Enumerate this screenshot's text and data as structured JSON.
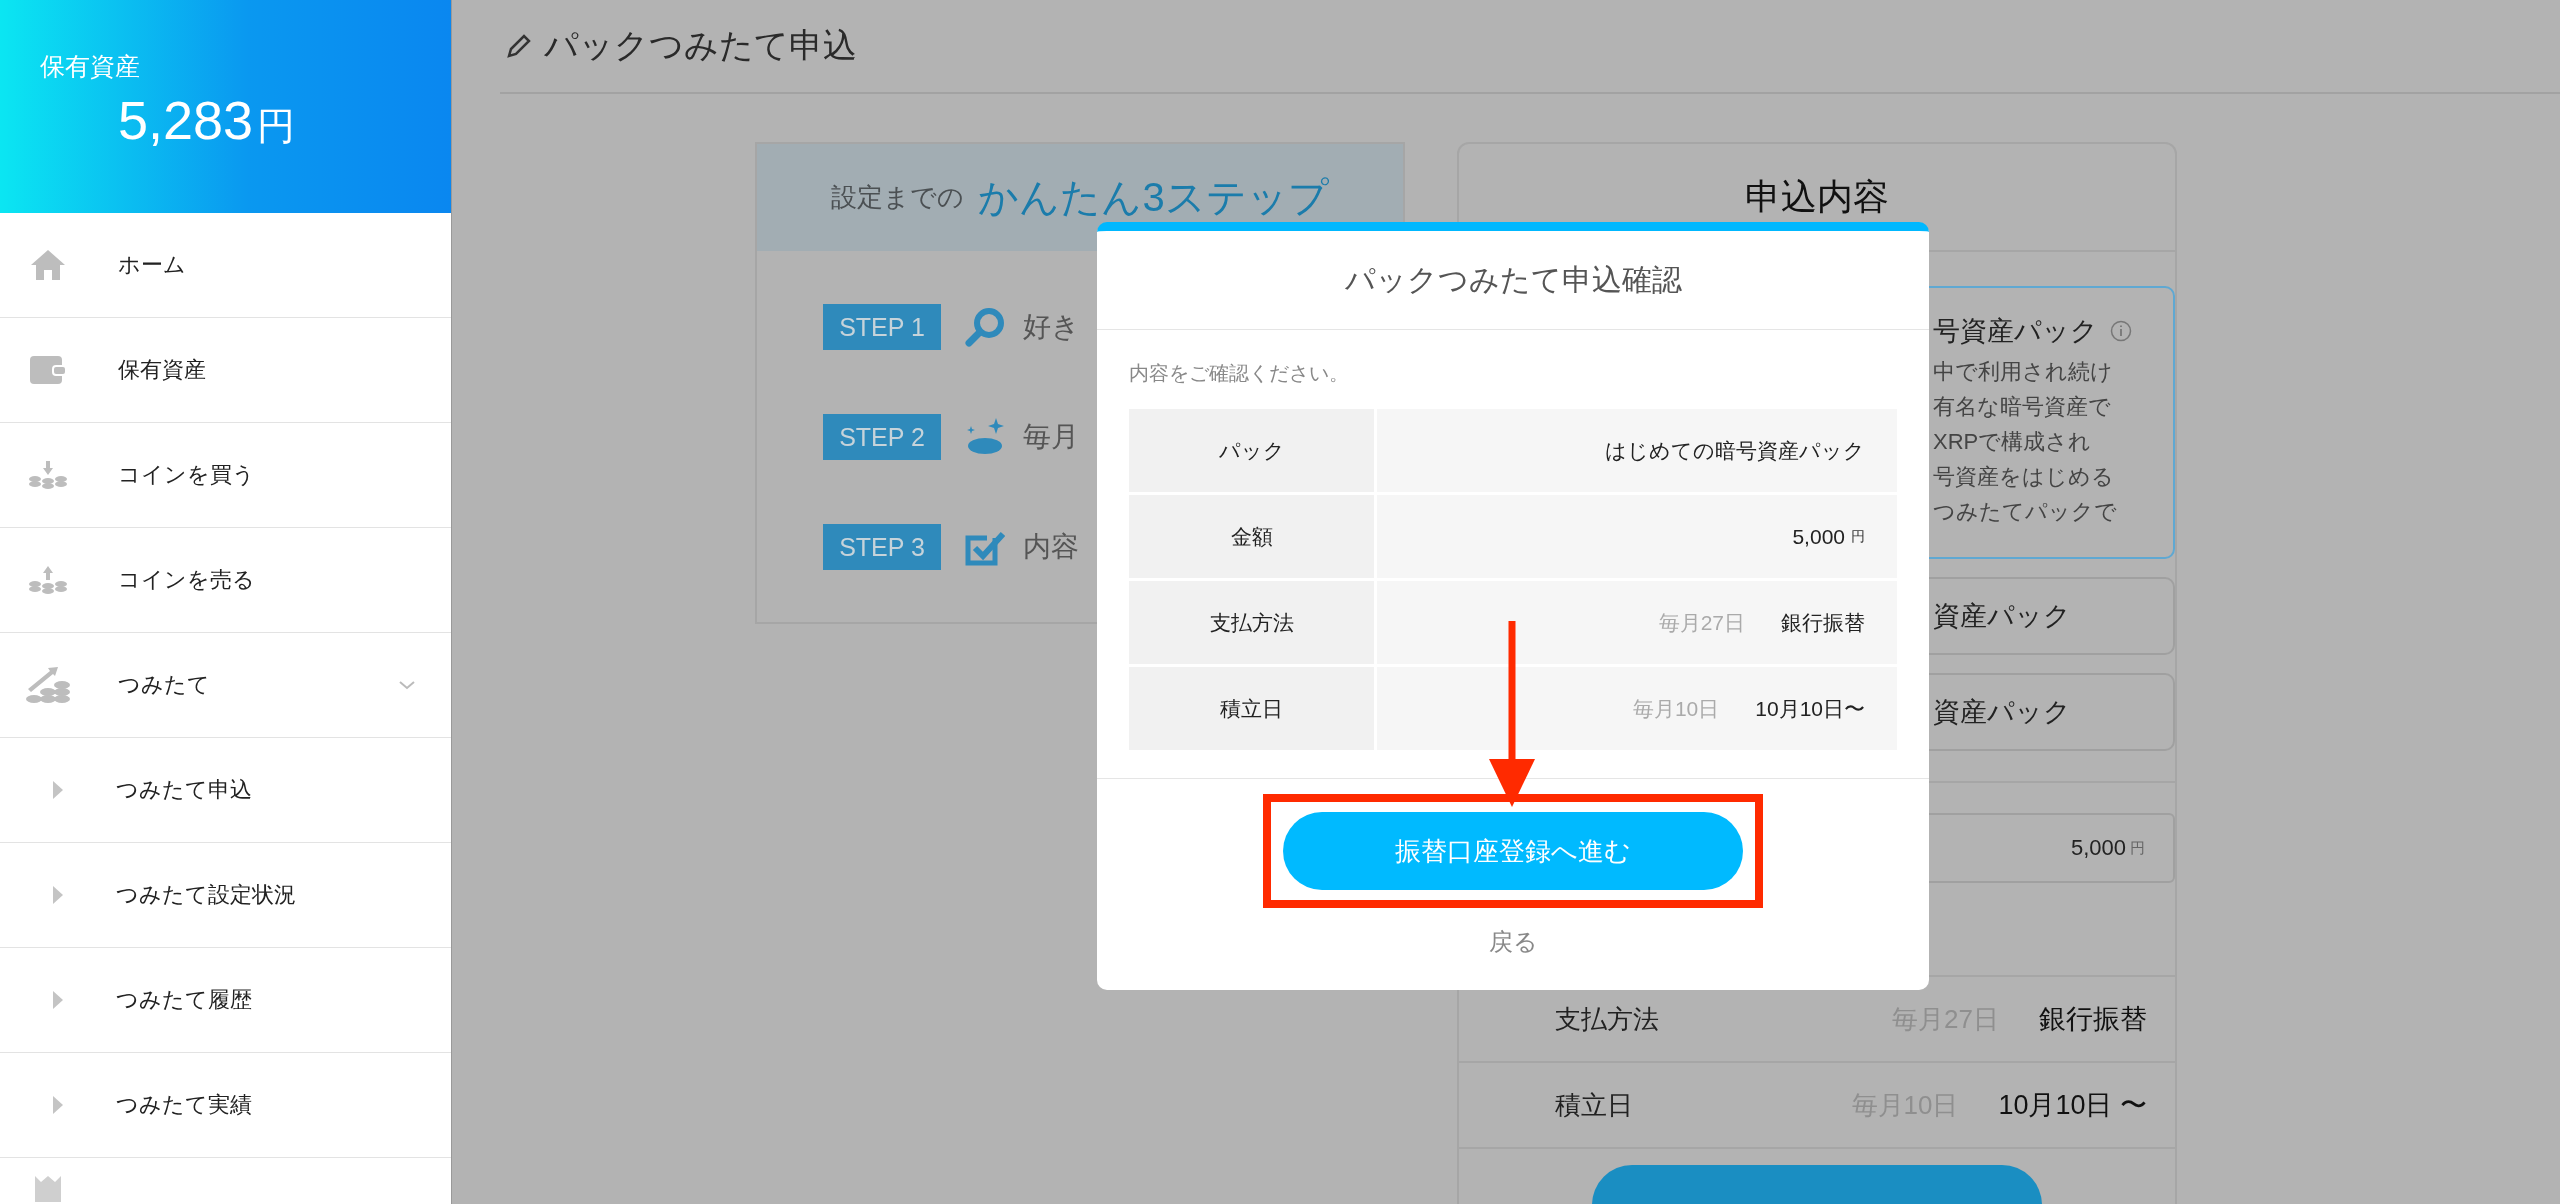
{
  "sidebar": {
    "balance_label": "保有資産",
    "balance_value": "5,283",
    "balance_unit": "円",
    "items": [
      {
        "label": "ホーム",
        "kind": "home"
      },
      {
        "label": "保有資産",
        "kind": "wallet"
      },
      {
        "label": "コインを買う",
        "kind": "buy"
      },
      {
        "label": "コインを売る",
        "kind": "sell"
      },
      {
        "label": "つみたて",
        "kind": "savings",
        "expanded": true,
        "children": [
          {
            "label": "つみたて申込"
          },
          {
            "label": "つみたて設定状況"
          },
          {
            "label": "つみたて履歴"
          },
          {
            "label": "つみたて実績"
          }
        ]
      }
    ]
  },
  "page_title": "パックつみたて申込",
  "steps_panel": {
    "title_prefix": "設定までの",
    "title_emphasis": "かんたん3ステップ",
    "steps": [
      {
        "badge": "STEP 1",
        "kind": "search",
        "text": "好き"
      },
      {
        "badge": "STEP 2",
        "kind": "coin",
        "text": "毎月"
      },
      {
        "badge": "STEP 3",
        "kind": "check",
        "text": "内容"
      }
    ]
  },
  "summary_panel": {
    "title": "申込内容",
    "packs": [
      {
        "name": "号資産パック",
        "selected": true,
        "description": [
          "中で利用され続け",
          "有名な暗号資産で",
          "XRPで構成され",
          "号資産をはじめる",
          "つみたてパックで"
        ]
      },
      {
        "name": "資産パック",
        "selected": false
      },
      {
        "name": "資産パック",
        "selected": false
      }
    ],
    "amount": {
      "value": "5,000",
      "unit": "円"
    },
    "rows": [
      {
        "label": "支払方法",
        "note": "毎月27日",
        "value": "銀行振替"
      },
      {
        "label": "積立日",
        "note": "毎月10日",
        "value": "10月10日 〜"
      }
    ]
  },
  "modal": {
    "title": "パックつみたて申込確認",
    "message": "内容をご確認ください。",
    "rows": [
      {
        "label": "パック",
        "value": "はじめての暗号資産パック"
      },
      {
        "label": "金額",
        "value": "5,000",
        "unit": "円"
      },
      {
        "label": "支払方法",
        "note": "毎月27日",
        "value": "銀行振替"
      },
      {
        "label": "積立日",
        "note": "毎月10日",
        "value": "10月10日〜"
      }
    ],
    "primary_button": "振替口座登録へ進む",
    "secondary_link": "戻る"
  }
}
